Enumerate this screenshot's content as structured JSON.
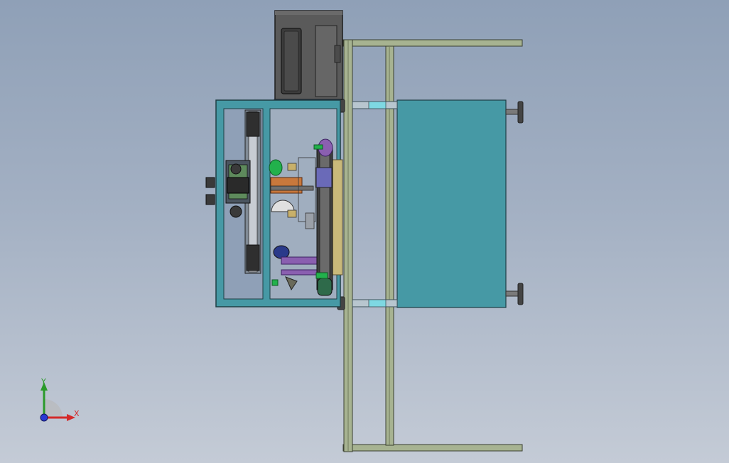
{
  "viewport": {
    "background_top": "#8fa0b7",
    "background_bottom": "#c4cbd6"
  },
  "model": {
    "frame_color": "#4a9aa8",
    "rail_color": "#a7b391",
    "cabinet_color": "#4a4a4a",
    "accent_green": "#22b14c",
    "accent_purple": "#8a5fb0",
    "accent_orange": "#c8783c"
  },
  "triad": {
    "x_label": "X",
    "y_label": "Y",
    "x_color": "#d42a2a",
    "y_color": "#2a9a2a",
    "z_color": "#2a3ad4"
  }
}
